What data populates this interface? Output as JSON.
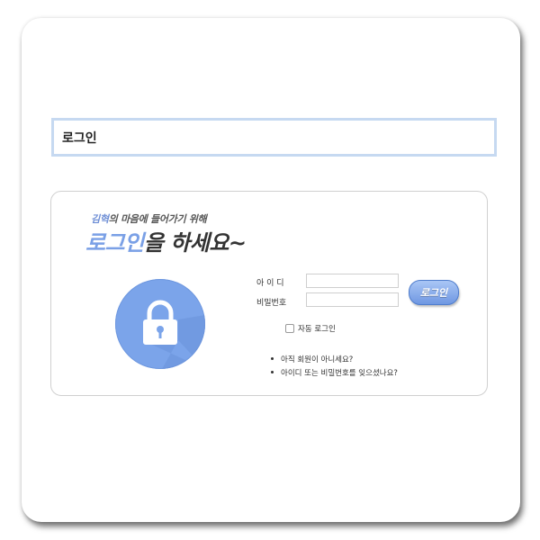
{
  "page": {
    "title": "로그인"
  },
  "greeting": {
    "small_name": "김혁",
    "small_rest": "의 마음에 들어가기 위해",
    "big_blue": "로그인",
    "big_rest": "을 하세요~"
  },
  "form": {
    "id_label": "아 이 디",
    "password_label": "비밀번호",
    "id_value": "",
    "password_value": "",
    "login_button": "로그인",
    "auto_login_label": "자동 로그인",
    "auto_login_checked": false
  },
  "links": [
    {
      "label": "아직 회원이 아니세요?"
    },
    {
      "label": "아이디 또는 비밀번호를 잊으셨나요?"
    }
  ],
  "icons": {
    "lock": "lock-icon"
  },
  "colors": {
    "accent": "#7aa0e6",
    "title_border": "#c6d9f1",
    "lock_circle": "#7ba4ea"
  }
}
